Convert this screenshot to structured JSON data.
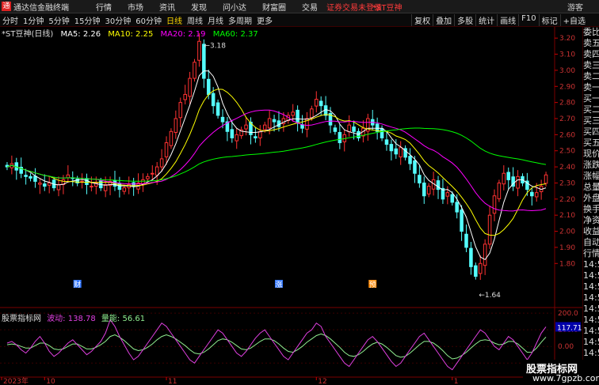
{
  "app": {
    "logo_char": "通",
    "name": "通达信金融终端",
    "menu": [
      "行情",
      "市场",
      "资讯",
      "发现",
      "问小达",
      "财富圈",
      "交易"
    ],
    "login_status": "证券交易未登录",
    "stock": "*ST豆神",
    "guest": "游客"
  },
  "toolbar": {
    "periods": [
      "分时",
      "1分钟",
      "5分钟",
      "15分钟",
      "30分钟",
      "60分钟",
      "日线",
      "周线",
      "月线",
      "多周期",
      "更多"
    ],
    "active": "日线",
    "right_buttons": [
      "复权",
      "叠加",
      "多股",
      "统计",
      "画线",
      "F10",
      "标记",
      "+自选"
    ]
  },
  "main_info": {
    "title": "*ST豆神(日线)",
    "ma5": "MA5: 2.26",
    "ma10": "MA10: 2.25",
    "ma20": "MA20: 2.19",
    "ma60": "MA60: 2.37"
  },
  "price_axis": [
    "3.20",
    "3.10",
    "3.00",
    "2.90",
    "2.80",
    "2.70",
    "2.60",
    "2.50",
    "2.40",
    "2.30",
    "2.20",
    "2.10",
    "2.00",
    "1.90",
    "1.80"
  ],
  "annotations": {
    "high": "3.18",
    "low": "1.64",
    "markers": [
      "财",
      "涨",
      "预"
    ]
  },
  "indicator": {
    "name": "股票指标网",
    "bodong": "波动: 138.78",
    "liangneng": "量能: 56.61",
    "axis": [
      "200.0",
      "100.0",
      "0.00",
      "-100.0"
    ],
    "current": "117.71"
  },
  "date_axis": {
    "labels": [
      "2023年",
      "10",
      "11",
      "12",
      "1",
      "2",
      "3"
    ]
  },
  "right_panel": [
    "委比",
    "卖五",
    "卖四",
    "卖三",
    "卖二",
    "卖一",
    "买一",
    "买二",
    "买三",
    "买四",
    "买五",
    "现价",
    "涨跌",
    "涨幅",
    "总量",
    "外盘",
    "换手",
    "净资",
    "收益",
    "自动",
    "行情",
    "14:54",
    "14:54",
    "14:55",
    "14:55",
    "14:55",
    "14:55",
    "14:55",
    "14:55",
    "14:55",
    "14:56",
    "14:56"
  ],
  "watermark": {
    "line1": "股票指标网",
    "line2": "www.7gpzb.com"
  },
  "colors": {
    "up": "#ff3232",
    "down": "#54fcfc",
    "ma5": "#ffffff",
    "ma10": "#ffff00",
    "ma20": "#ff00ff",
    "ma60": "#00ff00",
    "bodong": "#e040e0",
    "liangneng": "#90ee90"
  },
  "chart_data": {
    "type": "candlestick",
    "price_range": [
      1.6,
      3.25
    ],
    "high_label": 3.18,
    "low_label": 1.64,
    "closes": [
      2.4,
      2.42,
      2.38,
      2.36,
      2.34,
      2.33,
      2.31,
      2.3,
      2.28,
      2.3,
      2.27,
      2.29,
      2.32,
      2.35,
      2.33,
      2.3,
      2.31,
      2.29,
      2.28,
      2.3,
      2.27,
      2.29,
      2.31,
      2.28,
      2.26,
      2.27,
      2.29,
      2.28,
      2.3,
      2.32,
      2.34,
      2.36,
      2.4,
      2.45,
      2.55,
      2.62,
      2.7,
      2.8,
      2.85,
      2.95,
      3.05,
      3.18,
      2.95,
      2.85,
      2.78,
      2.72,
      2.68,
      2.62,
      2.58,
      2.6,
      2.63,
      2.66,
      2.6,
      2.58,
      2.62,
      2.66,
      2.7,
      2.68,
      2.65,
      2.7,
      2.72,
      2.74,
      2.68,
      2.64,
      2.7,
      2.76,
      2.82,
      2.78,
      2.72,
      2.66,
      2.62,
      2.55,
      2.6,
      2.66,
      2.62,
      2.58,
      2.64,
      2.7,
      2.66,
      2.62,
      2.58,
      2.54,
      2.5,
      2.48,
      2.52,
      2.46,
      2.42,
      2.36,
      2.3,
      2.22,
      2.28,
      2.32,
      2.26,
      2.2,
      2.24,
      2.18,
      2.12,
      2.0,
      1.9,
      1.78,
      1.72,
      1.8,
      1.92,
      2.1,
      2.22,
      2.3,
      2.36,
      2.32,
      2.28,
      2.34,
      2.3,
      2.26,
      2.22,
      2.24,
      2.28,
      2.35
    ],
    "bodong": [
      20,
      30,
      10,
      -20,
      -40,
      -10,
      30,
      60,
      20,
      -30,
      -60,
      -40,
      -10,
      20,
      40,
      10,
      -20,
      -50,
      -30,
      0,
      30,
      80,
      160,
      120,
      60,
      10,
      -40,
      -80,
      -60,
      -20,
      20,
      60,
      100,
      140,
      120,
      80,
      40,
      0,
      -40,
      -80,
      -100,
      -60,
      -20,
      20,
      60,
      100,
      80,
      40,
      0,
      -40,
      -60,
      -30,
      10,
      50,
      80,
      100,
      60,
      20,
      -20,
      -60,
      -80,
      -40,
      0,
      40,
      80,
      100,
      140,
      120,
      60,
      20,
      -20,
      -60,
      -100,
      -120,
      -80,
      -40,
      0,
      40,
      60,
      30,
      -10,
      -50,
      -90,
      -120,
      -100,
      -60,
      -20,
      20,
      60,
      80,
      40,
      0,
      -40,
      -80,
      -120,
      -140,
      -100,
      -60,
      -20,
      20,
      60,
      100,
      80,
      40,
      0,
      -20,
      20,
      60,
      40,
      0,
      -40,
      -80,
      -40,
      20,
      80,
      117.71
    ],
    "liangneng": [
      10,
      15,
      10,
      0,
      -10,
      -10,
      5,
      20,
      20,
      5,
      -15,
      -20,
      -15,
      0,
      15,
      15,
      0,
      -15,
      -15,
      -5,
      10,
      30,
      60,
      70,
      55,
      35,
      10,
      -15,
      -25,
      -20,
      -5,
      15,
      40,
      60,
      70,
      60,
      45,
      25,
      5,
      -20,
      -40,
      -45,
      -35,
      -15,
      10,
      35,
      45,
      40,
      25,
      5,
      -15,
      -20,
      -10,
      10,
      30,
      45,
      45,
      35,
      15,
      -10,
      -30,
      -35,
      -20,
      0,
      25,
      45,
      65,
      75,
      65,
      45,
      20,
      -5,
      -35,
      -55,
      -60,
      -50,
      -30,
      -5,
      15,
      25,
      15,
      -5,
      -30,
      -55,
      -65,
      -60,
      -40,
      -15,
      10,
      30,
      30,
      20,
      0,
      -25,
      -55,
      -75,
      -70,
      -55,
      -35,
      -10,
      15,
      35,
      40,
      35,
      20,
      10,
      15,
      30,
      30,
      15,
      -10,
      -35,
      -35,
      -10,
      25,
      56.61
    ]
  }
}
